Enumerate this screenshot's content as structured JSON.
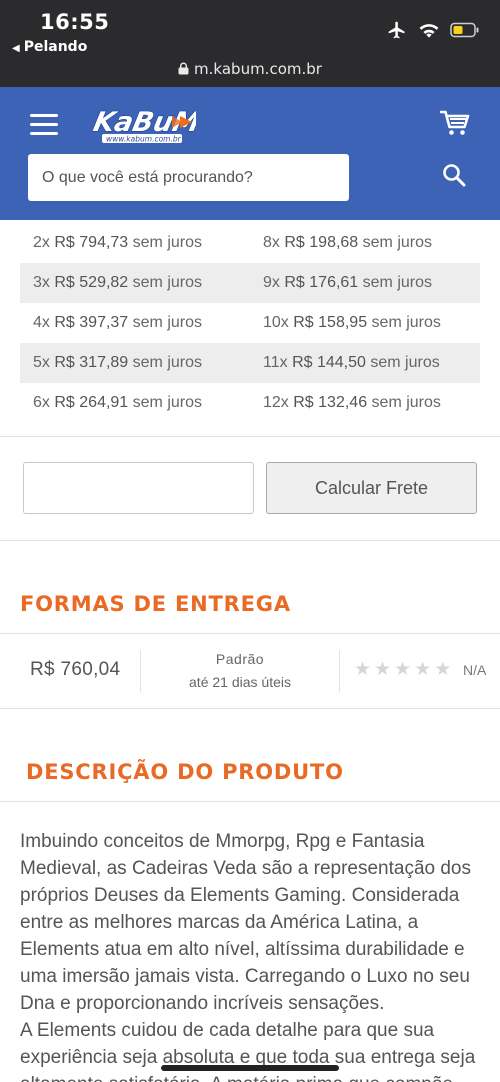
{
  "status_bar": {
    "time": "16:55",
    "back_label": "Pelando",
    "url": "m.kabum.com.br",
    "icons": [
      "airplane-icon",
      "wifi-icon",
      "battery-icon"
    ]
  },
  "header": {
    "logo_text": "KaBuM!",
    "logo_subtext": "www.kabum.com.br",
    "search_placeholder": "O que você está procurando?",
    "icons": [
      "menu-icon",
      "cart-icon",
      "search-icon"
    ]
  },
  "installments": [
    {
      "left": {
        "count": "2x",
        "currency": "R$",
        "amount": "794,73",
        "note": "sem juros"
      },
      "right": {
        "count": "8x",
        "currency": "R$",
        "amount": "198,68",
        "note": "sem juros"
      }
    },
    {
      "left": {
        "count": "3x",
        "currency": "R$",
        "amount": "529,82",
        "note": "sem juros"
      },
      "right": {
        "count": "9x",
        "currency": "R$",
        "amount": "176,61",
        "note": "sem juros"
      }
    },
    {
      "left": {
        "count": "4x",
        "currency": "R$",
        "amount": "397,37",
        "note": "sem juros"
      },
      "right": {
        "count": "10x",
        "currency": "R$",
        "amount": "158,95",
        "note": "sem juros"
      }
    },
    {
      "left": {
        "count": "5x",
        "currency": "R$",
        "amount": "317,89",
        "note": "sem juros"
      },
      "right": {
        "count": "11x",
        "currency": "R$",
        "amount": "144,50",
        "note": "sem juros"
      }
    },
    {
      "left": {
        "count": "6x",
        "currency": "R$",
        "amount": "264,91",
        "note": "sem juros"
      },
      "right": {
        "count": "12x",
        "currency": "R$",
        "amount": "132,46",
        "note": "sem juros"
      }
    }
  ],
  "shipping_calc": {
    "cep_value": "",
    "button_label": "Calcular Frete"
  },
  "delivery": {
    "title": "FORMAS DE ENTREGA",
    "price": "R$ 760,04",
    "method": "Padrão",
    "eta": "até 21 dias úteis",
    "rating_stars": 0,
    "rating_label": "N/A"
  },
  "description": {
    "title": "DESCRIÇÃO DO PRODUTO",
    "paragraph_1": "Imbuindo conceitos de Mmorpg, Rpg e Fantasia Medieval, as Cadeiras Veda são a representação dos próprios Deuses da Elements Gaming. Considerada entre as melhores marcas da América Latina, a Elements atua em alto nível, altíssima durabilidade e uma imersão jamais vista. Carregando o Luxo no seu Dna e proporcionando incríveis sensações.",
    "paragraph_2": "A Elements cuidou de cada detalhe para que sua experiência seja absoluta e que toda sua entrega seja altamente satisfatória. A matéria prima que compõe"
  },
  "colors": {
    "status_bar_bg": "#2b2b2d",
    "header_bg": "#3d63b6",
    "accent_orange": "#e86a24",
    "battery_yellow": "#f5d31b"
  }
}
